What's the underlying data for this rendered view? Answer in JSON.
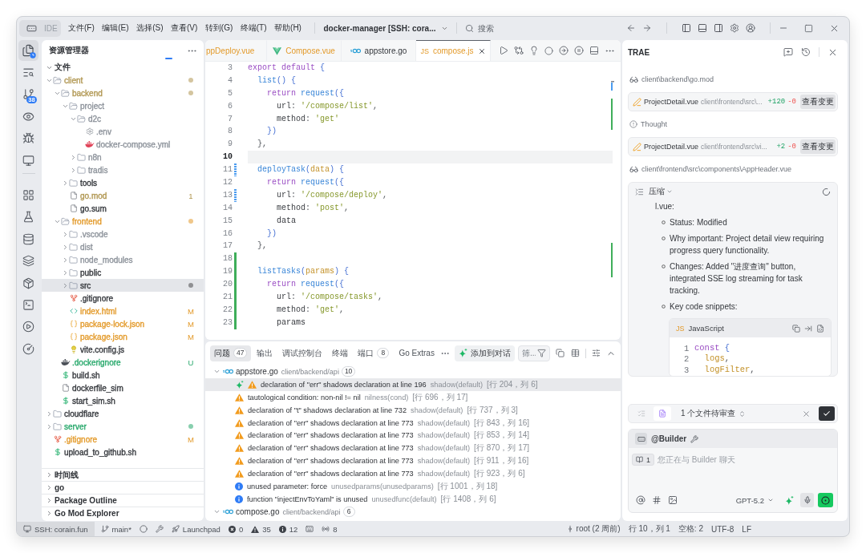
{
  "title_bar": {
    "app_label": "IDE",
    "menus": [
      "文件(F)",
      "编辑(E)",
      "选择(S)",
      "查看(V)",
      "转到(G)",
      "终端(T)",
      "帮助(H)"
    ],
    "workspace": "docker-manager [SSH: cora...",
    "search": {
      "placeholder": "搜索"
    }
  },
  "activity_bar": {
    "top": [
      {
        "kind": "files",
        "selected": true
      },
      {
        "kind": "search",
        "selected": false
      },
      {
        "kind": "branch",
        "selected": false,
        "badge": "38"
      },
      {
        "kind": "eye",
        "selected": false
      },
      {
        "kind": "bug",
        "selected": false
      },
      {
        "kind": "monitor",
        "selected": false
      }
    ],
    "bottom": [
      {
        "kind": "grid",
        "selected": false
      },
      {
        "kind": "flask",
        "selected": false
      },
      {
        "kind": "database",
        "selected": false
      },
      {
        "kind": "layers",
        "selected": false
      },
      {
        "kind": "package",
        "selected": false
      },
      {
        "kind": "terminal",
        "selected": false
      },
      {
        "kind": "play",
        "selected": false
      },
      {
        "kind": "gauge",
        "selected": false
      }
    ]
  },
  "sidebar": {
    "title": "资源管理器",
    "section": {
      "label": "文件",
      "expanded": true
    },
    "tree": [
      {
        "name": "client",
        "kind": "folder",
        "expanded": true,
        "color": "#b09650",
        "dot": true,
        "selected": false,
        "children": [
          {
            "name": "backend",
            "kind": "folder",
            "expanded": true,
            "color": "#b09650",
            "dot": true,
            "selected": false,
            "children": [
              {
                "name": "project",
                "kind": "folder",
                "expanded": true,
                "color": "#8c929a",
                "selected": false,
                "children": [
                  {
                    "name": "d2c",
                    "kind": "folder",
                    "expanded": true,
                    "color": "#8c929a",
                    "selected": false,
                    "children": [
                      {
                        "name": ".env",
                        "kind": "config",
                        "color": "#8c929a",
                        "selected": false
                      },
                      {
                        "name": "docker-compose.yml",
                        "kind": "compose",
                        "color": "#8c929a",
                        "selected": false
                      }
                    ]
                  },
                  {
                    "name": "n8n",
                    "kind": "folder",
                    "expanded": false,
                    "color": "#8c929a",
                    "selected": false
                  },
                  {
                    "name": "tradis",
                    "kind": "folder",
                    "expanded": false,
                    "color": "#8c929a",
                    "selected": false
                  }
                ]
              },
              {
                "name": "tools",
                "kind": "folder",
                "expanded": false,
                "color": "#33363b",
                "selected": false
              },
              {
                "name": "go.mod",
                "kind": "file",
                "color": "#b09650",
                "badge": "1",
                "selected": false
              },
              {
                "name": "go.sum",
                "kind": "file",
                "color": "#33363b",
                "selected": false
              }
            ]
          },
          {
            "name": "frontend",
            "kind": "folder",
            "expanded": true,
            "color": "#e39a2a",
            "dot": true,
            "selected": false,
            "children": [
              {
                "name": ".vscode",
                "kind": "folder",
                "expanded": false,
                "color": "#8c929a",
                "selected": false
              },
              {
                "name": "dist",
                "kind": "folder",
                "expanded": false,
                "color": "#8c929a",
                "selected": false
              },
              {
                "name": "node_modules",
                "kind": "folder",
                "expanded": false,
                "color": "#8c929a",
                "selected": false
              },
              {
                "name": "public",
                "kind": "folder",
                "expanded": false,
                "color": "#33363b",
                "selected": false
              },
              {
                "name": "src",
                "kind": "folder",
                "expanded": false,
                "color": "#33363b",
                "dot": true,
                "selected": true
              },
              {
                "name": ".gitignore",
                "kind": "git",
                "color": "#33363b",
                "selected": false
              },
              {
                "name": "index.html",
                "kind": "html",
                "color": "#e39a2a",
                "badge": "M",
                "selected": false
              },
              {
                "name": "package-lock.json",
                "kind": "json",
                "color": "#e39a2a",
                "badge": "M",
                "selected": false
              },
              {
                "name": "package.json",
                "kind": "json",
                "color": "#e39a2a",
                "badge": "M",
                "selected": false
              },
              {
                "name": "vite.config.js",
                "kind": "vite",
                "color": "#33363b",
                "selected": false
              }
            ]
          },
          {
            "name": ".dockerignore",
            "kind": "docker",
            "color": "#27a86b",
            "badge": "U",
            "selected": false
          },
          {
            "name": "build.sh",
            "kind": "shell",
            "color": "#33363b",
            "selected": false
          },
          {
            "name": "dockerfile_sim",
            "kind": "file",
            "color": "#33363b",
            "selected": false
          },
          {
            "name": "start_sim.sh",
            "kind": "shell",
            "color": "#33363b",
            "selected": false
          }
        ]
      },
      {
        "name": "cloudflare",
        "kind": "folder",
        "expanded": false,
        "color": "#33363b",
        "selected": false
      },
      {
        "name": "server",
        "kind": "folder",
        "expanded": false,
        "color": "#27a86b",
        "dot": true,
        "selected": false
      },
      {
        "name": ".gitignore",
        "kind": "git",
        "color": "#e39a2a",
        "badge": "M",
        "selected": false
      },
      {
        "name": "upload_to_github.sh",
        "kind": "shell",
        "color": "#33363b",
        "selected": false
      }
    ],
    "panels": [
      {
        "label": "时间线",
        "expanded": false
      },
      {
        "label": "go",
        "expanded": false
      },
      {
        "label": "Package Outline",
        "expanded": false
      },
      {
        "label": "Go Mod Explorer",
        "expanded": false
      }
    ]
  },
  "editor": {
    "tabs": [
      {
        "label": "ppDeploy.vue",
        "kind": "text",
        "modified": true,
        "selected": false
      },
      {
        "label": "Compose.vue",
        "kind": "vue",
        "modified": true,
        "selected": false
      },
      {
        "label": "appstore.go",
        "kind": "go",
        "modified": false,
        "selected": false
      },
      {
        "label": "compose.js",
        "kind": "js",
        "icon_text": "JS",
        "modified": true,
        "selected": true
      }
    ],
    "lines": [
      {
        "number": "3",
        "kind": "unchanged",
        "current": false,
        "tokens": [
          {
            "kind": "keyword",
            "text": "export default"
          },
          {
            "kind": "bracket",
            "text": " {"
          }
        ]
      },
      {
        "number": "4",
        "kind": "unchanged",
        "current": false,
        "tokens": [
          {
            "kind": "function",
            "text": "  list"
          },
          {
            "kind": "bracket",
            "text": "() {"
          }
        ]
      },
      {
        "number": "5",
        "kind": "unchanged",
        "current": false,
        "tokens": [
          {
            "kind": "keyword",
            "text": "    return"
          },
          {
            "kind": "function",
            "text": " request"
          },
          {
            "kind": "bracket",
            "text": "({"
          }
        ]
      },
      {
        "number": "6",
        "kind": "unchanged",
        "current": false,
        "tokens": [
          {
            "kind": "property",
            "text": "      url"
          },
          {
            "kind": "punct",
            "text": ": "
          },
          {
            "kind": "string",
            "text": "'/compose/list'"
          },
          {
            "kind": "punct",
            "text": ","
          }
        ]
      },
      {
        "number": "7",
        "kind": "unchanged",
        "current": false,
        "tokens": [
          {
            "kind": "property",
            "text": "      method"
          },
          {
            "kind": "punct",
            "text": ": "
          },
          {
            "kind": "string",
            "text": "'get'"
          }
        ]
      },
      {
        "number": "8",
        "kind": "unchanged",
        "current": false,
        "tokens": [
          {
            "kind": "bracket",
            "text": "    })"
          }
        ]
      },
      {
        "number": "9",
        "kind": "unchanged",
        "current": false,
        "tokens": [
          {
            "kind": "punct",
            "text": "  },"
          }
        ]
      },
      {
        "number": "10",
        "kind": "unchanged",
        "current": true
      },
      {
        "number": "11",
        "kind": "modified",
        "current": false,
        "tokens": [
          {
            "kind": "function",
            "text": "  deployTask"
          },
          {
            "kind": "bracket",
            "text": "("
          },
          {
            "kind": "param",
            "text": "data"
          },
          {
            "kind": "bracket",
            "text": ") {"
          }
        ]
      },
      {
        "number": "12",
        "kind": "unchanged",
        "current": false,
        "tokens": [
          {
            "kind": "keyword",
            "text": "    return"
          },
          {
            "kind": "function",
            "text": " request"
          },
          {
            "kind": "bracket",
            "text": "({"
          }
        ]
      },
      {
        "number": "13",
        "kind": "modified",
        "current": false,
        "tokens": [
          {
            "kind": "property",
            "text": "      url"
          },
          {
            "kind": "punct",
            "text": ": "
          },
          {
            "kind": "string",
            "text": "'/compose/deploy'"
          },
          {
            "kind": "punct",
            "text": ","
          }
        ]
      },
      {
        "number": "14",
        "kind": "unchanged",
        "current": false,
        "tokens": [
          {
            "kind": "property",
            "text": "      method"
          },
          {
            "kind": "punct",
            "text": ": "
          },
          {
            "kind": "string",
            "text": "'post'"
          },
          {
            "kind": "punct",
            "text": ","
          }
        ]
      },
      {
        "number": "15",
        "kind": "unchanged",
        "current": false,
        "tokens": [
          {
            "kind": "plain",
            "text": "      data"
          }
        ]
      },
      {
        "number": "16",
        "kind": "unchanged",
        "current": false,
        "tokens": [
          {
            "kind": "bracket",
            "text": "    })"
          }
        ]
      },
      {
        "number": "17",
        "kind": "unchanged",
        "current": false,
        "tokens": [
          {
            "kind": "punct",
            "text": "  },"
          }
        ]
      },
      {
        "number": "18",
        "kind": "added",
        "current": false
      },
      {
        "number": "19",
        "kind": "added",
        "current": false,
        "tokens": [
          {
            "kind": "function",
            "text": "  listTasks"
          },
          {
            "kind": "bracket",
            "text": "("
          },
          {
            "kind": "param",
            "text": "params"
          },
          {
            "kind": "bracket",
            "text": ") {"
          }
        ]
      },
      {
        "number": "20",
        "kind": "added",
        "current": false,
        "tokens": [
          {
            "kind": "keyword",
            "text": "    return"
          },
          {
            "kind": "function",
            "text": " request"
          },
          {
            "kind": "bracket",
            "text": "({"
          }
        ]
      },
      {
        "number": "21",
        "kind": "added",
        "current": false,
        "tokens": [
          {
            "kind": "property",
            "text": "      url"
          },
          {
            "kind": "punct",
            "text": ": "
          },
          {
            "kind": "string",
            "text": "'/compose/tasks'"
          },
          {
            "kind": "punct",
            "text": ","
          }
        ]
      },
      {
        "number": "22",
        "kind": "added",
        "current": false,
        "tokens": [
          {
            "kind": "property",
            "text": "      method"
          },
          {
            "kind": "punct",
            "text": ": "
          },
          {
            "kind": "string",
            "text": "'get'"
          },
          {
            "kind": "punct",
            "text": ","
          }
        ]
      },
      {
        "number": "23",
        "kind": "added",
        "current": false,
        "tokens": [
          {
            "kind": "plain",
            "text": "      params"
          }
        ]
      }
    ]
  },
  "panel": {
    "tabs": [
      {
        "label": "问题",
        "count": "47",
        "selected": true
      },
      {
        "label": "输出",
        "selected": false
      },
      {
        "label": "调试控制台",
        "selected": false
      },
      {
        "label": "终端",
        "selected": false
      },
      {
        "label": "端口",
        "count": "8",
        "selected": false
      },
      {
        "label": "Go Extras",
        "selected": false
      }
    ],
    "add_to_chat": "添加到对话",
    "filter": {
      "placeholder": "筛..."
    },
    "groups": [
      {
        "file": "appstore.go",
        "path": "client/backend/api",
        "count": "10",
        "expanded": true,
        "problems": [
          {
            "kind": "warning",
            "message": "declaration of \"err\" shadows declaration at line 196",
            "source": "shadow(default)",
            "location": "[行 204，列 6]",
            "selected": true
          },
          {
            "kind": "warning",
            "message": "tautological condition: non-nil != nil",
            "source": "nilness(cond)",
            "location": "[行 696，列 17]",
            "selected": false
          },
          {
            "kind": "warning",
            "message": "declaration of \"t\" shadows declaration at line 732",
            "source": "shadow(default)",
            "location": "[行 737，列 3]",
            "selected": false
          },
          {
            "kind": "warning",
            "message": "declaration of \"err\" shadows declaration at line 773",
            "source": "shadow(default)",
            "location": "[行 843，列 16]",
            "selected": false
          },
          {
            "kind": "warning",
            "message": "declaration of \"err\" shadows declaration at line 773",
            "source": "shadow(default)",
            "location": "[行 853，列 14]",
            "selected": false
          },
          {
            "kind": "warning",
            "message": "declaration of \"err\" shadows declaration at line 773",
            "source": "shadow(default)",
            "location": "[行 870，列 17]",
            "selected": false
          },
          {
            "kind": "warning",
            "message": "declaration of \"err\" shadows declaration at line 773",
            "source": "shadow(default)",
            "location": "[行 911，列 16]",
            "selected": false
          },
          {
            "kind": "warning",
            "message": "declaration of \"err\" shadows declaration at line 773",
            "source": "shadow(default)",
            "location": "[行 923，列 6]",
            "selected": false
          },
          {
            "kind": "info",
            "message": "unused parameter: force",
            "source": "unusedparams(unusedparams)",
            "location": "[行 1001，列 18]",
            "selected": false
          },
          {
            "kind": "info",
            "message": "function \"injectEnvToYaml\" is unused",
            "source": "unusedfunc(default)",
            "location": "[行 1408，列 6]",
            "selected": false
          }
        ]
      },
      {
        "file": "compose.go",
        "path": "client/backend/api",
        "count": "6",
        "expanded": true
      }
    ]
  },
  "assistant": {
    "title": "TRAE",
    "items": [
      {
        "kind": "read",
        "path": "client\\backend\\go.mod"
      },
      {
        "kind": "edit",
        "file": "ProjectDetail.vue",
        "path": "client\\frontend\\src\\...",
        "added": "+120",
        "removed": "-0",
        "action": "查看变更"
      },
      {
        "kind": "thought",
        "label": "Thought"
      },
      {
        "kind": "edit",
        "file": "ProjectDetail.vue",
        "path": "client\\frontend\\src\\vi...",
        "added": "+2",
        "removed": "-0",
        "action": "查看变更"
      },
      {
        "kind": "read",
        "path": "client\\frontend\\src\\components\\AppHeader.vue"
      },
      {
        "kind": "summary",
        "label": "压缩",
        "lead": "l.vue:",
        "bullets": [
          "Status: Modified",
          "Why important: Project detail view requiring progress query functionality.",
          "Changes: Added \"进度查询\" button, integrated SSE log streaming for task tracking.",
          "Key code snippets:"
        ],
        "code": {
          "icon_text": "JS",
          "language": "JavaScript",
          "lines": [
            {
              "number": "1",
              "tokens": [
                {
                  "kind": "keyword",
                  "text": "const"
                },
                {
                  "kind": "bracket",
                  "text": " {"
                }
              ]
            },
            {
              "number": "2",
              "tokens": [
                {
                  "kind": "variable",
                  "text": "  logs"
                },
                {
                  "kind": "punct",
                  "text": ","
                }
              ]
            },
            {
              "number": "3",
              "tokens": [
                {
                  "kind": "variable",
                  "text": "  logFilter"
                },
                {
                  "kind": "punct",
                  "text": ","
                }
              ]
            }
          ]
        }
      }
    ],
    "review": {
      "tabs": [
        {
          "kind": "list",
          "selected": false
        },
        {
          "kind": "file",
          "selected": true
        }
      ],
      "label": "1 个文件待审查"
    },
    "composer": {
      "agent": "@Builder",
      "context_count": "1",
      "placeholder": "您正在与 Builder 聊天",
      "model": "GPT-5.2"
    }
  },
  "status_bar": {
    "left": [
      {
        "kind": "remote",
        "label": "SSH: corain.fun"
      },
      {
        "kind": "branch",
        "label": "main*"
      },
      {
        "kind": "sync"
      },
      {
        "kind": "tool"
      },
      {
        "kind": "launchpad",
        "label": "Launchpad"
      },
      {
        "kind": "errors",
        "label": "0"
      },
      {
        "kind": "warnings",
        "label": "35"
      },
      {
        "kind": "infos",
        "label": "12"
      },
      {
        "kind": "keyboard"
      },
      {
        "kind": "ports",
        "label": "8"
      }
    ],
    "right": [
      {
        "kind": "commit",
        "label": "root (2 周前)"
      },
      {
        "kind": "text",
        "label": "行 10，列 1"
      },
      {
        "kind": "text",
        "label": "空格: 2"
      },
      {
        "kind": "text",
        "label": "UTF-8"
      },
      {
        "kind": "text",
        "label": "LF"
      }
    ]
  }
}
